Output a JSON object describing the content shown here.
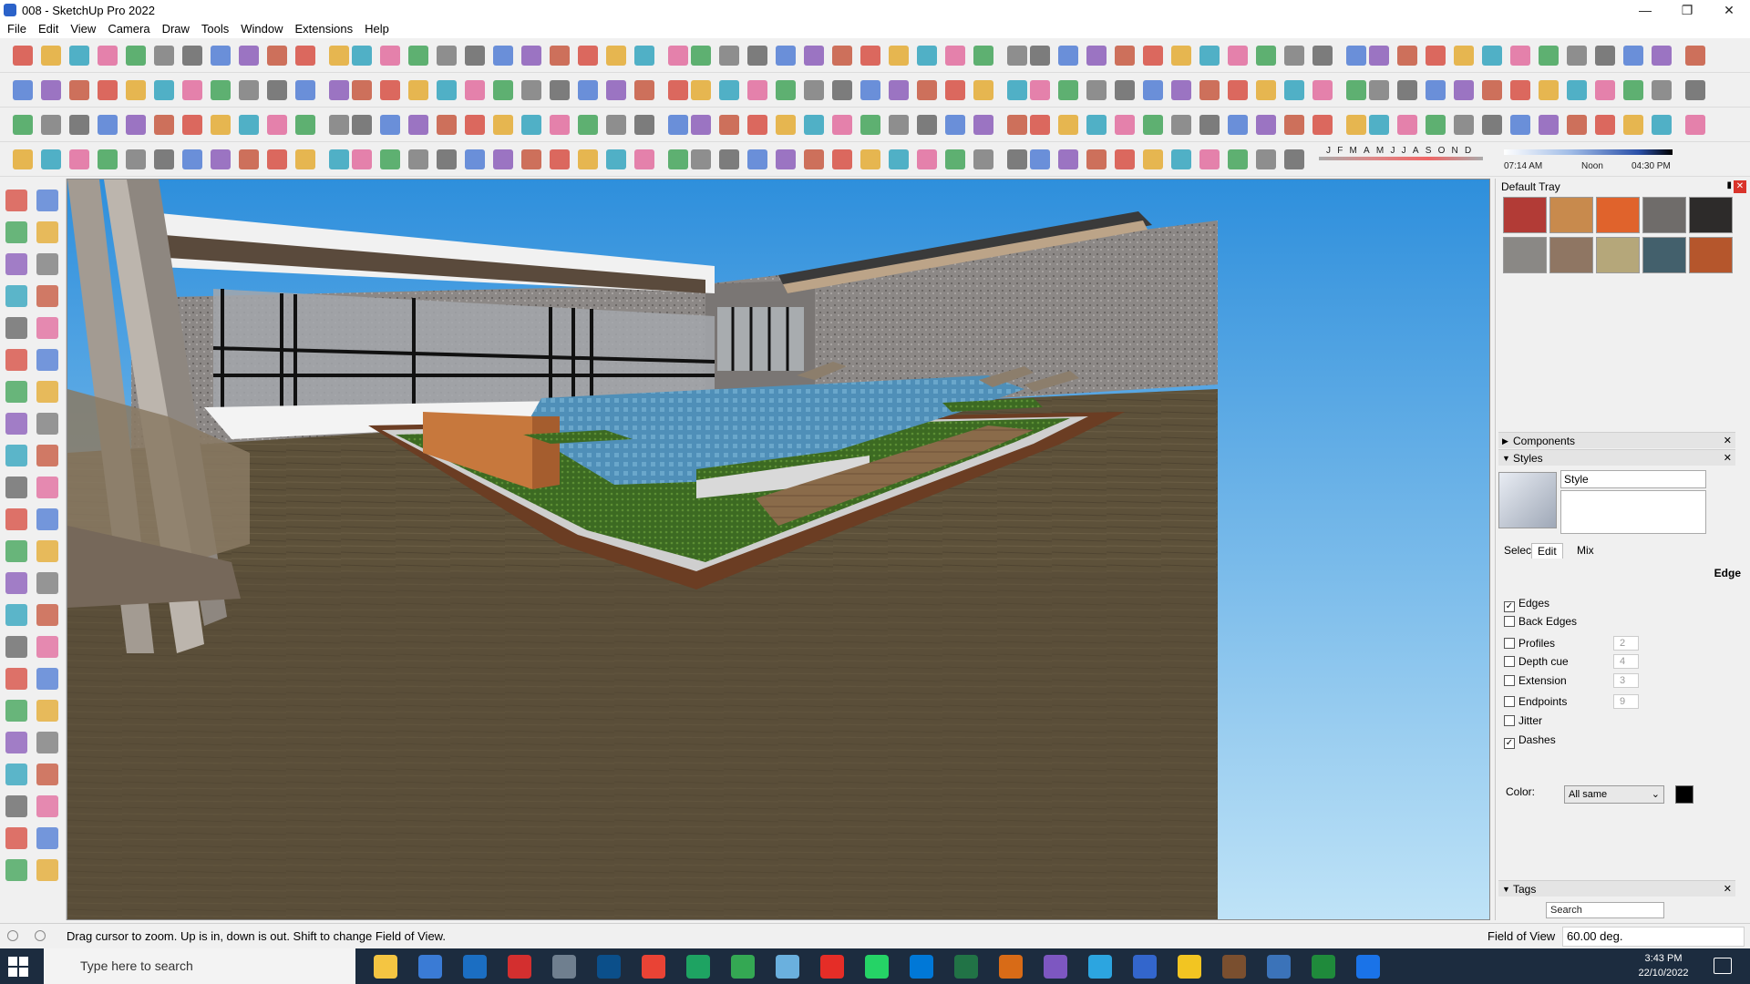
{
  "window": {
    "title": "008 - SketchUp Pro 2022",
    "minimize": "—",
    "maximize": "❐",
    "close": "✕"
  },
  "menu": [
    "File",
    "Edit",
    "View",
    "Camera",
    "Draw",
    "Tools",
    "Window",
    "Extensions",
    "Help"
  ],
  "shadow_settings": {
    "months": "JFMAMJJASOND",
    "time_start": "07:14 AM",
    "time_mid": "Noon",
    "time_end": "04:30 PM"
  },
  "tray": {
    "title": "Default Tray",
    "pin_icon": "pin-icon",
    "materials": [
      "#b23b36",
      "#c88a4d",
      "#e0632c",
      "#6f6c6a",
      "#2d2b2a",
      "#8a8885",
      "#8f7663",
      "#b5a77a",
      "#43606c",
      "#b5562c"
    ],
    "sections": {
      "components": "Components",
      "styles": "Styles",
      "tags": "Tags"
    },
    "style_name": "Style",
    "style_tabs": [
      "Select",
      "Edit",
      "Mix"
    ],
    "active_tab": "Edit",
    "edge_header": "Edge",
    "edge_settings": [
      {
        "label": "Edges",
        "checked": true,
        "value": ""
      },
      {
        "label": "Back Edges",
        "checked": false,
        "value": ""
      },
      {
        "label": "Profiles",
        "checked": false,
        "value": "2"
      },
      {
        "label": "Depth cue",
        "checked": false,
        "value": "4"
      },
      {
        "label": "Extension",
        "checked": false,
        "value": "3"
      },
      {
        "label": "Endpoints",
        "checked": false,
        "value": "9"
      },
      {
        "label": "Jitter",
        "checked": false,
        "value": ""
      },
      {
        "label": "Dashes",
        "checked": true,
        "value": ""
      }
    ],
    "color_label": "Color:",
    "color_value": "All same",
    "color_swatch": "#000000",
    "tags_search_placeholder": "Search"
  },
  "status": {
    "message": "Drag cursor to zoom.  Up is in, down is out. Shift to change Field of View.",
    "fov_label": "Field of View",
    "fov_value": "60.00 deg."
  },
  "taskbar": {
    "search_placeholder": "Type here to search",
    "time": "3:43 PM",
    "date": "22/10/2022"
  }
}
